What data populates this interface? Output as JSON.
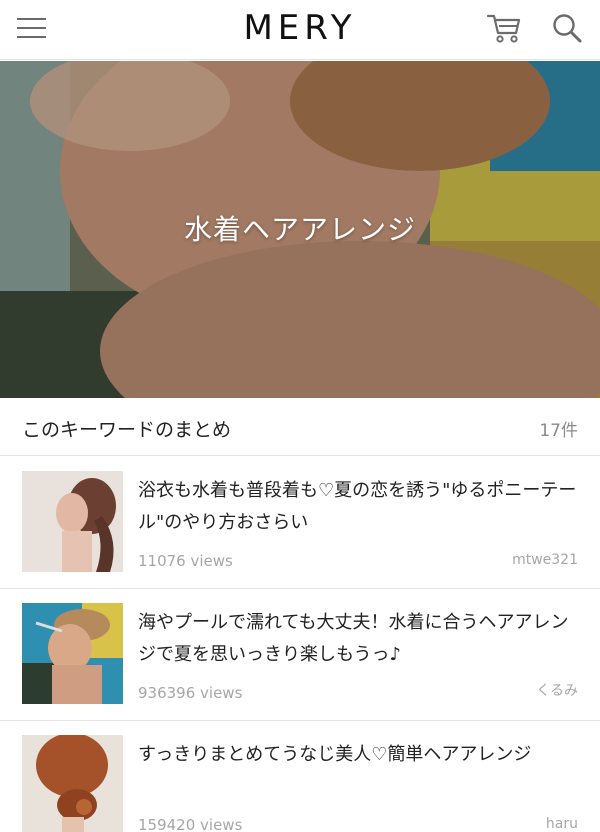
{
  "header": {
    "logo": "MERY",
    "menu_icon": "hamburger-menu-icon",
    "cart_icon": "cart-icon",
    "search_icon": "search-icon"
  },
  "hero": {
    "title": "水着ヘアアレンジ"
  },
  "section": {
    "title": "このキーワードのまとめ",
    "count": "17件"
  },
  "articles": [
    {
      "title": "浴衣も水着も普段着も♡夏の恋を誘う\"ゆるポニーテール\"のやり方おさらい",
      "views": "11076 views",
      "author": "mtwe321"
    },
    {
      "title": "海やプールで濡れても大丈夫！水着に合うヘアアレンジで夏を思いっきり楽しもうっ♪",
      "views": "936396 views",
      "author": "くるみ"
    },
    {
      "title": "すっきりまとめてうなじ美人♡簡単ヘアアレンジ",
      "views": "159420 views",
      "author": "haru"
    }
  ],
  "colors": {
    "text": "#222222",
    "muted": "#a6a6a6",
    "divider": "#e6e6e6"
  }
}
